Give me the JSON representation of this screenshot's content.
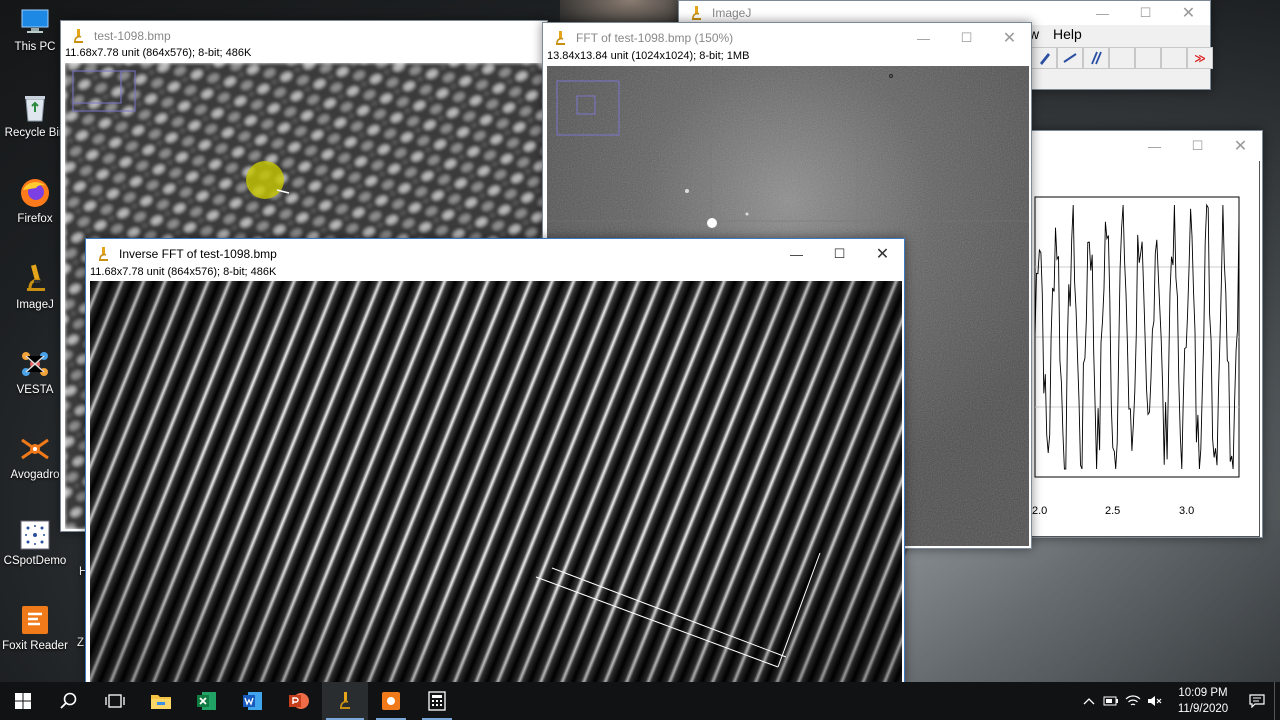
{
  "desktop": {
    "icons": [
      {
        "label": "This PC",
        "icon": "computer-icon"
      },
      {
        "label": "Recycle Bin",
        "icon": "recycle-bin-icon"
      },
      {
        "label": "Firefox",
        "icon": "firefox-icon"
      },
      {
        "label": "ImageJ",
        "icon": "microscope-icon"
      },
      {
        "label": "VESTA",
        "icon": "vesta-icon"
      },
      {
        "label": "Avogadro",
        "icon": "avogadro-icon"
      },
      {
        "label": "CSpotDemo",
        "icon": "cspot-icon"
      },
      {
        "label": "Foxit Reader",
        "icon": "foxit-icon"
      }
    ]
  },
  "windows": {
    "original": {
      "title": "test-1098.bmp",
      "info": "11.68x7.78 unit (864x576); 8-bit; 486K"
    },
    "fft": {
      "title": "FFT of test-1098.bmp (150%)",
      "info": "13.84x13.84 unit (1024x1024); 8-bit; 1MB"
    },
    "imagej": {
      "title": "ImageJ",
      "menu_partial": "w",
      "menu_help": "Help",
      "overflow": "≫"
    },
    "plot": {
      "x_ticks": [
        "2.0",
        "2.5",
        "3.0"
      ]
    },
    "inverse": {
      "title": "Inverse FFT of test-1098.bmp",
      "info": "11.68x7.78 unit (864x576); 8-bit; 486K"
    }
  },
  "taskbar": {
    "clock_time": "10:09 PM",
    "clock_date": "11/9/2020",
    "partial_labels": [
      "H",
      "Z"
    ]
  },
  "colors": {
    "accent": "#7aa7d8",
    "taskbar": "#101214",
    "roi_marker": "#c8c800"
  }
}
